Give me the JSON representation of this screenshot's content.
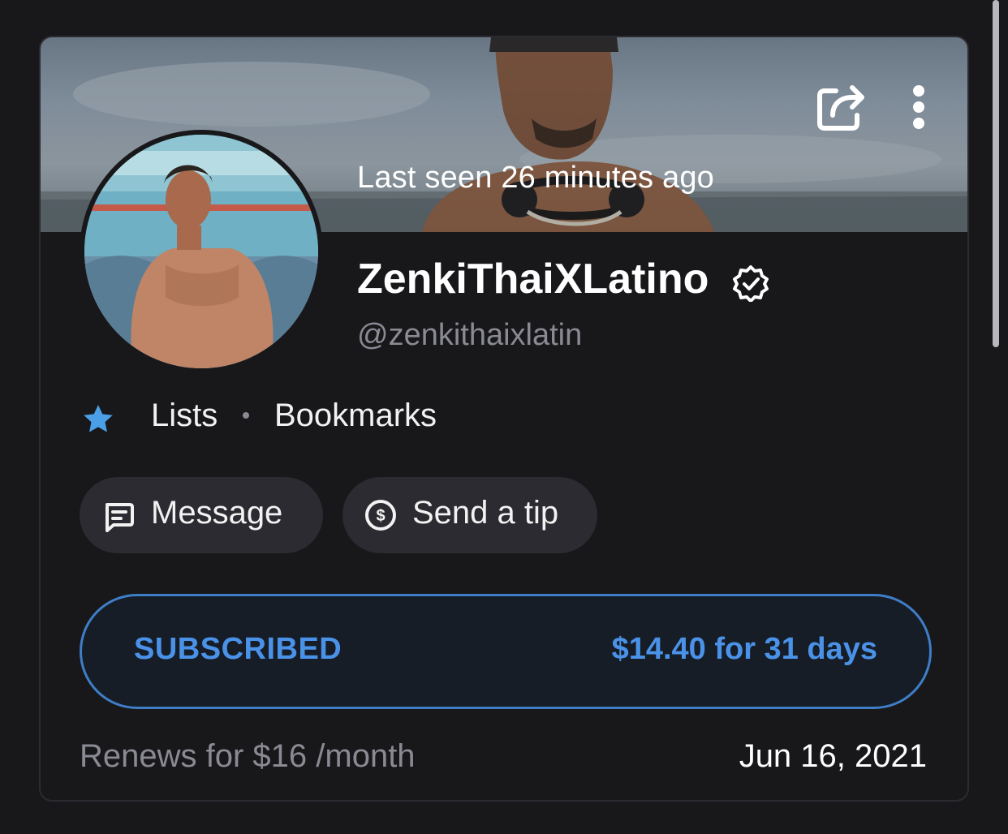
{
  "profile": {
    "last_seen": "Last seen 26 minutes ago",
    "display_name": "ZenkiThaiXLatino",
    "handle": "@zenkithaixlatin",
    "verified": true
  },
  "lists": {
    "lists_label": "Lists",
    "bookmarks_label": "Bookmarks",
    "star_icon": "star-icon"
  },
  "actions": {
    "message_label": "Message",
    "message_icon": "message-icon",
    "tip_label": "Send a tip",
    "tip_icon": "dollar-circle-icon"
  },
  "subscription": {
    "status": "SUBSCRIBED",
    "price": "$14.40 for 31 days",
    "renews": "Renews for $16 /month",
    "renew_date": "Jun 16, 2021"
  },
  "colors": {
    "background": "#18181b",
    "accent": "#4a92e8",
    "star": "#4a9fe6",
    "muted": "#8a8a93",
    "pill": "#2b2b31"
  }
}
